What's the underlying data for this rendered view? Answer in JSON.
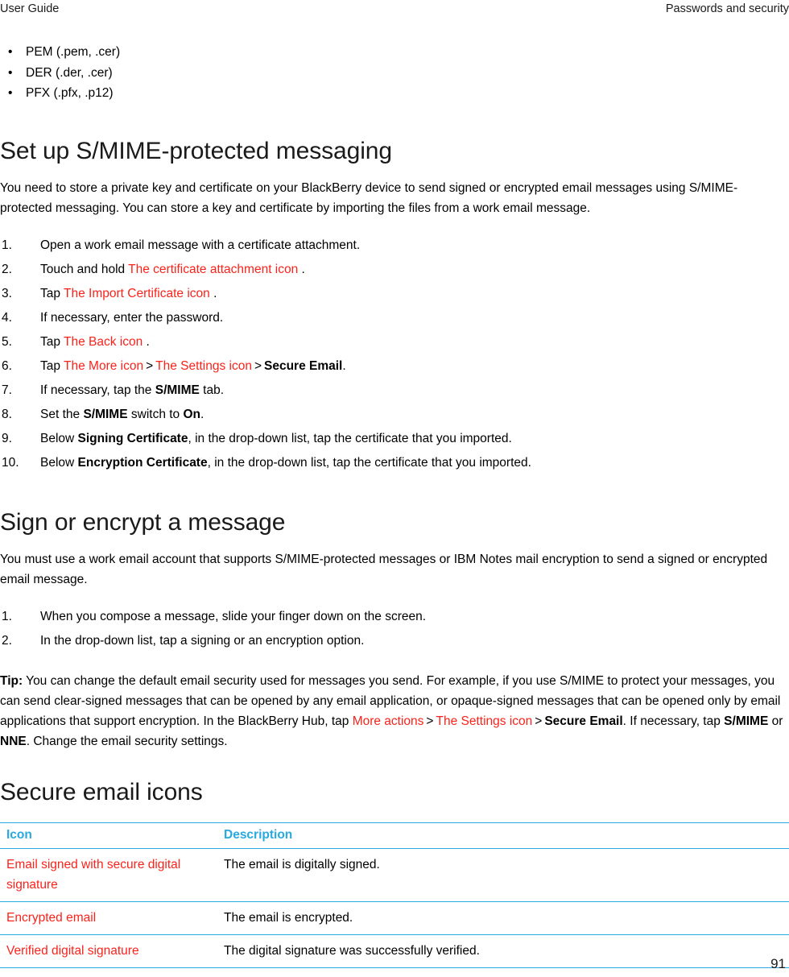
{
  "header": {
    "left": "User Guide",
    "right": "Passwords and security"
  },
  "format_bullets": [
    "PEM (.pem, .cer)",
    "DER (.der, .cer)",
    "PFX (.pfx, .p12)"
  ],
  "bullet_glyph": "•",
  "sections": {
    "smime_setup": {
      "heading": "Set up S/MIME-protected messaging",
      "intro": "You need to store a private key and certificate on your BlackBerry device to send signed or encrypted email messages using S/MIME-protected messaging. You can store a key and certificate by importing the files from a work email message.",
      "steps": [
        {
          "num": "1.",
          "parts": [
            {
              "text": "Open a work email message with a certificate attachment.",
              "style": "plain"
            }
          ]
        },
        {
          "num": "2.",
          "parts": [
            {
              "text": "Touch and hold ",
              "style": "plain"
            },
            {
              "text": "The certificate attachment icon",
              "style": "alt-red"
            },
            {
              "text": " .",
              "style": "plain"
            }
          ]
        },
        {
          "num": "3.",
          "parts": [
            {
              "text": "Tap ",
              "style": "plain"
            },
            {
              "text": "The Import Certificate icon",
              "style": "alt-red"
            },
            {
              "text": " .",
              "style": "plain"
            }
          ]
        },
        {
          "num": "4.",
          "parts": [
            {
              "text": "If necessary, enter the password.",
              "style": "plain"
            }
          ]
        },
        {
          "num": "5.",
          "parts": [
            {
              "text": "Tap ",
              "style": "plain"
            },
            {
              "text": "The Back icon",
              "style": "alt-red"
            },
            {
              "text": " .",
              "style": "plain"
            }
          ]
        },
        {
          "num": "6.",
          "parts": [
            {
              "text": "Tap ",
              "style": "plain"
            },
            {
              "text": "The More icon",
              "style": "alt-red"
            },
            {
              "text": ">",
              "style": "gt"
            },
            {
              "text": "The Settings icon",
              "style": "alt-red"
            },
            {
              "text": ">",
              "style": "gt"
            },
            {
              "text": "Secure Email",
              "style": "bold"
            },
            {
              "text": ".",
              "style": "plain"
            }
          ]
        },
        {
          "num": "7.",
          "parts": [
            {
              "text": "If necessary, tap the ",
              "style": "plain"
            },
            {
              "text": "S/MIME",
              "style": "bold"
            },
            {
              "text": " tab.",
              "style": "plain"
            }
          ]
        },
        {
          "num": "8.",
          "parts": [
            {
              "text": "Set the ",
              "style": "plain"
            },
            {
              "text": "S/MIME",
              "style": "bold"
            },
            {
              "text": " switch to ",
              "style": "plain"
            },
            {
              "text": "On",
              "style": "bold"
            },
            {
              "text": ".",
              "style": "plain"
            }
          ]
        },
        {
          "num": "9.",
          "parts": [
            {
              "text": "Below ",
              "style": "plain"
            },
            {
              "text": "Signing Certificate",
              "style": "bold"
            },
            {
              "text": ", in the drop-down list, tap the certificate that you imported.",
              "style": "plain"
            }
          ]
        },
        {
          "num": "10.",
          "parts": [
            {
              "text": "Below ",
              "style": "plain"
            },
            {
              "text": "Encryption Certificate",
              "style": "bold"
            },
            {
              "text": ", in the drop-down list, tap the certificate that you imported.",
              "style": "plain"
            }
          ]
        }
      ]
    },
    "sign_encrypt": {
      "heading": "Sign or encrypt a message",
      "intro": "You must use a work email account that supports S/MIME-protected messages or IBM Notes mail encryption to send a signed or encrypted email message.",
      "steps": [
        {
          "num": "1.",
          "parts": [
            {
              "text": "When you compose a message, slide your finger down on the screen.",
              "style": "plain"
            }
          ]
        },
        {
          "num": "2.",
          "parts": [
            {
              "text": "In the drop-down list, tap a signing or an encryption option.",
              "style": "plain"
            }
          ]
        }
      ],
      "tip": {
        "label": "Tip:",
        "parts": [
          {
            "text": " You can change the default email security used for messages you send. For example, if you use S/MIME to protect your messages, you can send clear-signed messages that can be opened by any email application, or opaque-signed messages that can be opened only by email applications that support encryption. In the BlackBerry Hub, tap ",
            "style": "plain"
          },
          {
            "text": "More actions",
            "style": "alt-red"
          },
          {
            "text": ">",
            "style": "gt"
          },
          {
            "text": "The Settings icon",
            "style": "alt-red"
          },
          {
            "text": ">",
            "style": "gt"
          },
          {
            "text": "Secure Email",
            "style": "bold"
          },
          {
            "text": ". If necessary, tap ",
            "style": "plain"
          },
          {
            "text": "S/MIME",
            "style": "bold"
          },
          {
            "text": " or ",
            "style": "plain"
          },
          {
            "text": "NNE",
            "style": "bold"
          },
          {
            "text": ". Change the email security settings.",
            "style": "plain"
          }
        ]
      }
    },
    "secure_email_icons": {
      "heading": "Secure email icons",
      "table": {
        "columns": [
          "Icon",
          "Description"
        ],
        "rows": [
          {
            "icon": "Email signed with secure digital signature",
            "description": "The email is digitally signed."
          },
          {
            "icon": "Encrypted email",
            "description": "The email is encrypted."
          },
          {
            "icon": "Verified digital signature",
            "description": "The digital signature was successfully verified."
          }
        ]
      }
    }
  },
  "footer": {
    "page_number": "91"
  },
  "colors": {
    "alt_text_red": "#fa231b",
    "table_accent_blue": "#28a9e0",
    "body_text": "#000000"
  }
}
